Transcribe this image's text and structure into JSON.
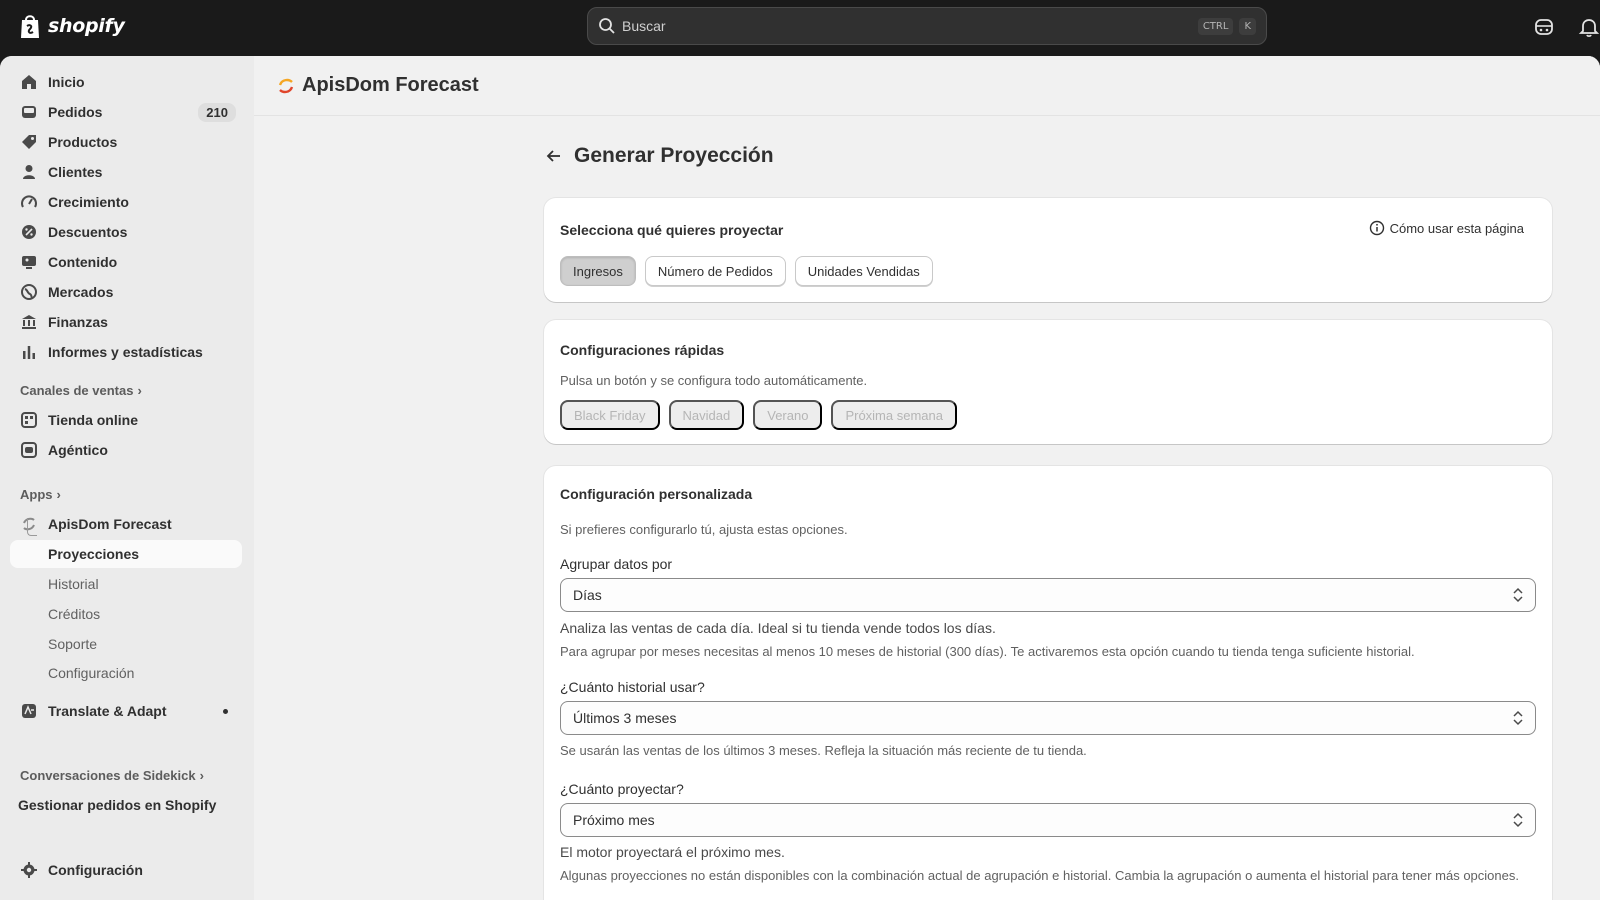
{
  "topbar": {
    "brand": "shopify",
    "search_placeholder": "Buscar",
    "shortcut_ctrl": "CTRL",
    "shortcut_key": "K"
  },
  "sidebar": {
    "items": [
      {
        "label": "Inicio",
        "icon": "home-icon"
      },
      {
        "label": "Pedidos",
        "icon": "inbox-icon",
        "badge": "210"
      },
      {
        "label": "Productos",
        "icon": "tag-icon"
      },
      {
        "label": "Clientes",
        "icon": "person-icon"
      },
      {
        "label": "Crecimiento",
        "icon": "gauge-icon"
      },
      {
        "label": "Descuentos",
        "icon": "discount-icon"
      },
      {
        "label": "Contenido",
        "icon": "content-icon"
      },
      {
        "label": "Mercados",
        "icon": "globe-icon"
      },
      {
        "label": "Finanzas",
        "icon": "bank-icon"
      },
      {
        "label": "Informes y estadísticas",
        "icon": "bar-chart-icon"
      }
    ],
    "sales_channels_title": "Canales de ventas",
    "sales_channels": [
      {
        "label": "Tienda online",
        "icon": "store-icon"
      },
      {
        "label": "Agéntico",
        "icon": "agent-icon"
      }
    ],
    "apps_title": "Apps",
    "app_name": "ApisDom Forecast",
    "app_subitems": [
      "Proyecciones",
      "Historial",
      "Créditos",
      "Soporte",
      "Configuración"
    ],
    "translate_app": "Translate & Adapt",
    "sidekick_title": "Conversaciones de Sidekick",
    "sidekick_item": "Gestionar pedidos en Shopify",
    "settings": "Configuración"
  },
  "main": {
    "app_title": "ApisDom Forecast",
    "page_title": "Generar Proyección",
    "card1": {
      "title": "Selecciona qué quieres proyectar",
      "help_link": "Cómo usar esta página",
      "options": [
        "Ingresos",
        "Número de Pedidos",
        "Unidades Vendidas"
      ],
      "selected": "Ingresos"
    },
    "card2": {
      "title": "Configuraciones rápidas",
      "subtitle": "Pulsa un botón y se configura todo automáticamente.",
      "buttons": [
        "Black Friday",
        "Navidad",
        "Verano",
        "Próxima semana"
      ]
    },
    "card3": {
      "title": "Configuración personalizada",
      "subtitle": "Si prefieres configurarlo tú, ajusta estas opciones.",
      "group_label": "Agrupar datos por",
      "group_value": "Días",
      "group_help1": "Analiza las ventas de cada día. Ideal si tu tienda vende todos los días.",
      "group_help2": "Para agrupar por meses necesitas al menos 10 meses de historial (300 días). Te activaremos esta opción cuando tu tienda tenga suficiente historial.",
      "history_label": "¿Cuánto historial usar?",
      "history_value": "Últimos 3 meses",
      "history_help": "Se usarán las ventas de los últimos 3 meses. Refleja la situación más reciente de tu tienda.",
      "project_label": "¿Cuánto proyectar?",
      "project_value": "Próximo mes",
      "project_help1": "El motor proyectará el próximo mes.",
      "project_help2": "Algunas proyecciones no están disponibles con la combinación actual de agrupación e historial. Cambia la agrupación o aumenta el historial para tener más opciones."
    }
  },
  "colors": {
    "topbar_bg": "#1a1a1a",
    "sidebar_bg": "#ebebeb",
    "main_bg": "#f1f1f1",
    "card_bg": "#ffffff",
    "accent_orange": "#f5a623"
  }
}
